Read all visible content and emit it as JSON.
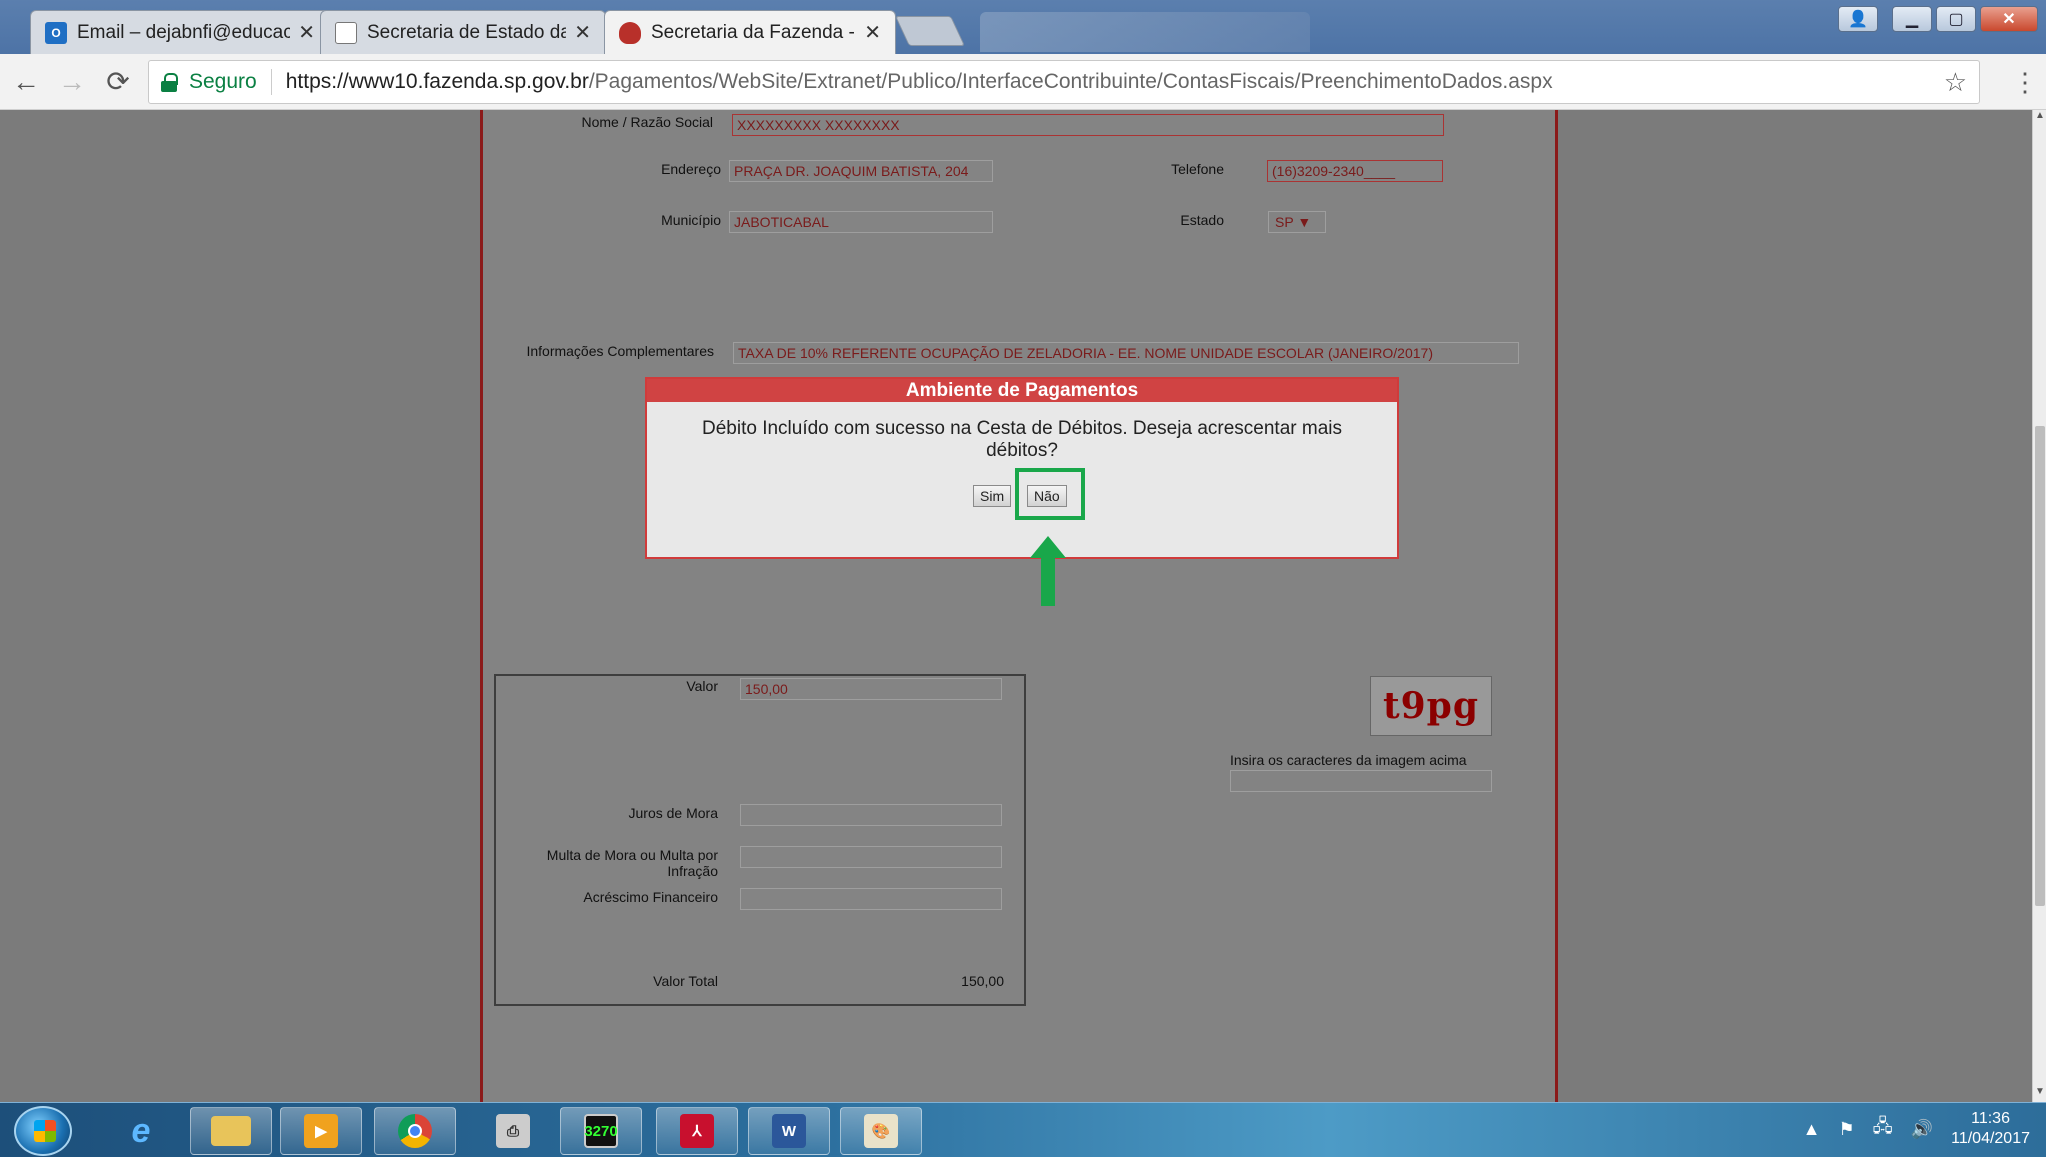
{
  "browser": {
    "tabs": [
      {
        "title": "Email – dejabnfi@educac",
        "icon": "outlook-icon"
      },
      {
        "title": "Secretaria de Estado da E",
        "icon": "document-icon"
      },
      {
        "title": "Secretaria da Fazenda - C",
        "icon": "sp-crest-icon"
      }
    ],
    "omnibox": {
      "secure_label": "Seguro",
      "url_host": "https://www10.fazenda.sp.gov.br",
      "url_path": "/Pagamentos/WebSite/Extranet/Publico/InterfaceContribuinte/ContasFiscais/PreenchimentoDados.aspx"
    }
  },
  "form": {
    "nome_label": "Nome / Razão Social",
    "nome_value": "XXXXXXXXX XXXXXXXX",
    "endereco_label": "Endereço",
    "endereco_value": "PRAÇA DR. JOAQUIM BATISTA, 204",
    "telefone_label": "Telefone",
    "telefone_value": "(16)3209-2340____",
    "municipio_label": "Município",
    "municipio_value": "JABOTICABAL",
    "estado_label": "Estado",
    "estado_value": "SP",
    "info_label": "Informações Complementares",
    "info_value": "TAXA DE 10% REFERENTE OCUPAÇÃO DE ZELADORIA - EE. NOME UNIDADE ESCOLAR (JANEIRO/2017)",
    "valor_label": "Valor",
    "valor_value": "150,00",
    "juros_label": "Juros de Mora",
    "multa_label_1": "Multa de Mora ou Multa por",
    "multa_label_2": "Infração",
    "acrescimo_label": "Acréscimo Financeiro",
    "valor_total_label": "Valor Total",
    "valor_total_value": "150,00",
    "captcha_text": "t9pg",
    "captcha_label": "Insira os caracteres da imagem acima"
  },
  "modal": {
    "title": "Ambiente de Pagamentos",
    "message": "Débito Incluído com sucesso na Cesta de Débitos. Deseja acrescentar mais débitos?",
    "yes_label": "Sim",
    "no_label": "Não"
  },
  "taskbar": {
    "apps": [
      "internet-explorer",
      "file-explorer",
      "media-player",
      "chrome",
      "printer",
      "terminal-3270",
      "acrobat",
      "word",
      "paint"
    ],
    "terminal_label": "3270",
    "word_label": "W",
    "time": "11:36",
    "date": "11/04/2017"
  },
  "colors": {
    "modal_header": "#d04343",
    "highlight": "#19a74a",
    "panel_border": "#8b1a1a",
    "secure_green": "#0b8043"
  }
}
